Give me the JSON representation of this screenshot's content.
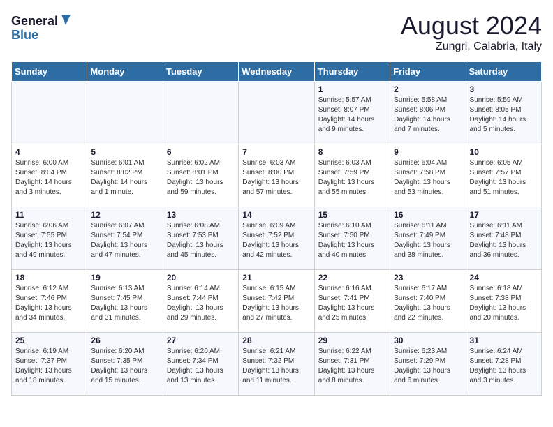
{
  "logo": {
    "line1": "General",
    "line2": "Blue"
  },
  "title": "August 2024",
  "location": "Zungri, Calabria, Italy",
  "weekdays": [
    "Sunday",
    "Monday",
    "Tuesday",
    "Wednesday",
    "Thursday",
    "Friday",
    "Saturday"
  ],
  "weeks": [
    [
      {
        "day": "",
        "content": ""
      },
      {
        "day": "",
        "content": ""
      },
      {
        "day": "",
        "content": ""
      },
      {
        "day": "",
        "content": ""
      },
      {
        "day": "1",
        "content": "Sunrise: 5:57 AM\nSunset: 8:07 PM\nDaylight: 14 hours\nand 9 minutes."
      },
      {
        "day": "2",
        "content": "Sunrise: 5:58 AM\nSunset: 8:06 PM\nDaylight: 14 hours\nand 7 minutes."
      },
      {
        "day": "3",
        "content": "Sunrise: 5:59 AM\nSunset: 8:05 PM\nDaylight: 14 hours\nand 5 minutes."
      }
    ],
    [
      {
        "day": "4",
        "content": "Sunrise: 6:00 AM\nSunset: 8:04 PM\nDaylight: 14 hours\nand 3 minutes."
      },
      {
        "day": "5",
        "content": "Sunrise: 6:01 AM\nSunset: 8:02 PM\nDaylight: 14 hours\nand 1 minute."
      },
      {
        "day": "6",
        "content": "Sunrise: 6:02 AM\nSunset: 8:01 PM\nDaylight: 13 hours\nand 59 minutes."
      },
      {
        "day": "7",
        "content": "Sunrise: 6:03 AM\nSunset: 8:00 PM\nDaylight: 13 hours\nand 57 minutes."
      },
      {
        "day": "8",
        "content": "Sunrise: 6:03 AM\nSunset: 7:59 PM\nDaylight: 13 hours\nand 55 minutes."
      },
      {
        "day": "9",
        "content": "Sunrise: 6:04 AM\nSunset: 7:58 PM\nDaylight: 13 hours\nand 53 minutes."
      },
      {
        "day": "10",
        "content": "Sunrise: 6:05 AM\nSunset: 7:57 PM\nDaylight: 13 hours\nand 51 minutes."
      }
    ],
    [
      {
        "day": "11",
        "content": "Sunrise: 6:06 AM\nSunset: 7:55 PM\nDaylight: 13 hours\nand 49 minutes."
      },
      {
        "day": "12",
        "content": "Sunrise: 6:07 AM\nSunset: 7:54 PM\nDaylight: 13 hours\nand 47 minutes."
      },
      {
        "day": "13",
        "content": "Sunrise: 6:08 AM\nSunset: 7:53 PM\nDaylight: 13 hours\nand 45 minutes."
      },
      {
        "day": "14",
        "content": "Sunrise: 6:09 AM\nSunset: 7:52 PM\nDaylight: 13 hours\nand 42 minutes."
      },
      {
        "day": "15",
        "content": "Sunrise: 6:10 AM\nSunset: 7:50 PM\nDaylight: 13 hours\nand 40 minutes."
      },
      {
        "day": "16",
        "content": "Sunrise: 6:11 AM\nSunset: 7:49 PM\nDaylight: 13 hours\nand 38 minutes."
      },
      {
        "day": "17",
        "content": "Sunrise: 6:11 AM\nSunset: 7:48 PM\nDaylight: 13 hours\nand 36 minutes."
      }
    ],
    [
      {
        "day": "18",
        "content": "Sunrise: 6:12 AM\nSunset: 7:46 PM\nDaylight: 13 hours\nand 34 minutes."
      },
      {
        "day": "19",
        "content": "Sunrise: 6:13 AM\nSunset: 7:45 PM\nDaylight: 13 hours\nand 31 minutes."
      },
      {
        "day": "20",
        "content": "Sunrise: 6:14 AM\nSunset: 7:44 PM\nDaylight: 13 hours\nand 29 minutes."
      },
      {
        "day": "21",
        "content": "Sunrise: 6:15 AM\nSunset: 7:42 PM\nDaylight: 13 hours\nand 27 minutes."
      },
      {
        "day": "22",
        "content": "Sunrise: 6:16 AM\nSunset: 7:41 PM\nDaylight: 13 hours\nand 25 minutes."
      },
      {
        "day": "23",
        "content": "Sunrise: 6:17 AM\nSunset: 7:40 PM\nDaylight: 13 hours\nand 22 minutes."
      },
      {
        "day": "24",
        "content": "Sunrise: 6:18 AM\nSunset: 7:38 PM\nDaylight: 13 hours\nand 20 minutes."
      }
    ],
    [
      {
        "day": "25",
        "content": "Sunrise: 6:19 AM\nSunset: 7:37 PM\nDaylight: 13 hours\nand 18 minutes."
      },
      {
        "day": "26",
        "content": "Sunrise: 6:20 AM\nSunset: 7:35 PM\nDaylight: 13 hours\nand 15 minutes."
      },
      {
        "day": "27",
        "content": "Sunrise: 6:20 AM\nSunset: 7:34 PM\nDaylight: 13 hours\nand 13 minutes."
      },
      {
        "day": "28",
        "content": "Sunrise: 6:21 AM\nSunset: 7:32 PM\nDaylight: 13 hours\nand 11 minutes."
      },
      {
        "day": "29",
        "content": "Sunrise: 6:22 AM\nSunset: 7:31 PM\nDaylight: 13 hours\nand 8 minutes."
      },
      {
        "day": "30",
        "content": "Sunrise: 6:23 AM\nSunset: 7:29 PM\nDaylight: 13 hours\nand 6 minutes."
      },
      {
        "day": "31",
        "content": "Sunrise: 6:24 AM\nSunset: 7:28 PM\nDaylight: 13 hours\nand 3 minutes."
      }
    ]
  ]
}
